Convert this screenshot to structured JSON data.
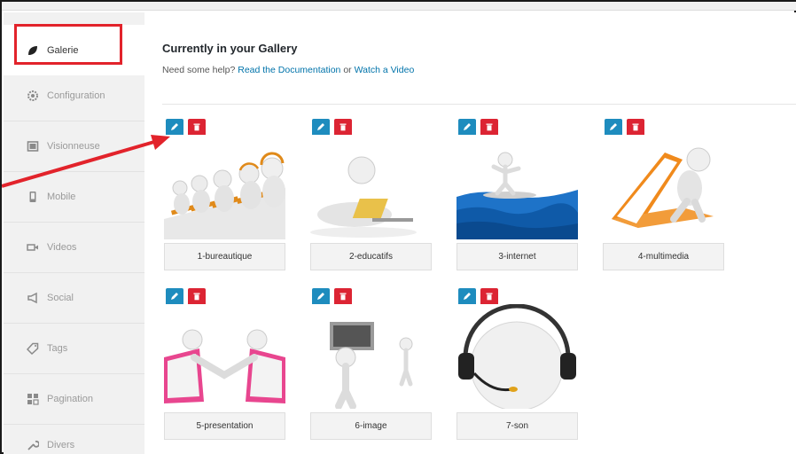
{
  "sidebar": {
    "items": [
      {
        "label": "Galerie",
        "icon": "leaf-icon"
      },
      {
        "label": "Configuration",
        "icon": "gear-icon"
      },
      {
        "label": "Visionneuse",
        "icon": "window-icon"
      },
      {
        "label": "Mobile",
        "icon": "mobile-icon"
      },
      {
        "label": "Videos",
        "icon": "video-icon"
      },
      {
        "label": "Social",
        "icon": "megaphone-icon"
      },
      {
        "label": "Tags",
        "icon": "tag-icon"
      },
      {
        "label": "Pagination",
        "icon": "pagination-icon"
      },
      {
        "label": "Divers",
        "icon": "wrench-icon"
      }
    ]
  },
  "main": {
    "title": "Currently in your Gallery",
    "help_prefix": "Need some help?",
    "doc_link": "Read the Documentation",
    "or_text": "or",
    "video_link": "Watch a Video"
  },
  "gallery": {
    "items": [
      {
        "label": "1-bureautique"
      },
      {
        "label": "2-educatifs"
      },
      {
        "label": "3-internet"
      },
      {
        "label": "4-multimedia"
      },
      {
        "label": "5-presentation"
      },
      {
        "label": "6-image"
      },
      {
        "label": "7-son"
      }
    ]
  },
  "colors": {
    "edit_button": "#1e8cbe",
    "delete_button": "#dc2433",
    "link": "#0073aa",
    "annotation_red": "#e2232b"
  }
}
